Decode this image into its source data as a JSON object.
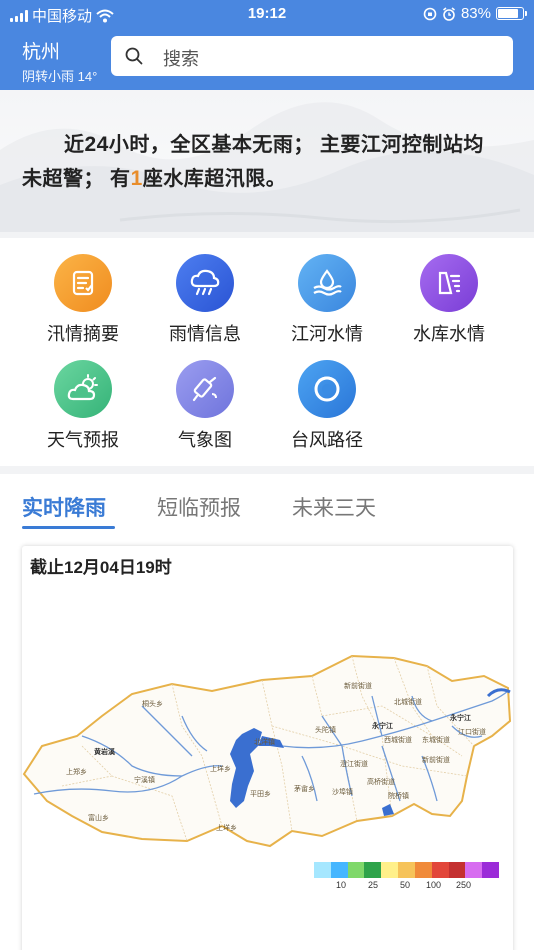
{
  "status_bar": {
    "carrier": "中国移动",
    "time": "19:12",
    "battery": "83%"
  },
  "header": {
    "city": "杭州",
    "weather": "阴转小雨 14°",
    "search_placeholder": "搜索"
  },
  "banner": {
    "p1": "近",
    "n1": "24",
    "p2": "小时，全区基本无雨；  主要江河控制站均未超警；  有",
    "n2": "1",
    "p3": "座水库超汛限。"
  },
  "menu": {
    "items": [
      {
        "label": "汛情摘要",
        "icon": "report-icon"
      },
      {
        "label": "雨情信息",
        "icon": "rain-cloud-icon"
      },
      {
        "label": "江河水情",
        "icon": "river-water-icon"
      },
      {
        "label": "水库水情",
        "icon": "reservoir-icon"
      },
      {
        "label": "天气预报",
        "icon": "weather-icon"
      },
      {
        "label": "气象图",
        "icon": "satellite-icon"
      },
      {
        "label": "台风路径",
        "icon": "typhoon-icon"
      }
    ]
  },
  "tabs": [
    {
      "label": "实时降雨",
      "active": true
    },
    {
      "label": "短临预报",
      "active": false
    },
    {
      "label": "未来三天",
      "active": false
    }
  ],
  "map": {
    "caption": "截止12月04日19时",
    "place_labels": [
      "新前街道",
      "北城街道",
      "桐头乡",
      "永宁江",
      "头陀镇",
      "永宁江",
      "江口街道",
      "北洋镇",
      "西城街道",
      "东城街道",
      "黄岩溪",
      "上郑乡",
      "宁溪镇",
      "上垟乡",
      "澄江街道",
      "新前街道",
      "高桥街道",
      "平田乡",
      "茅畲乡",
      "沙埠镇",
      "院桥镇",
      "富山乡",
      "上垟乡"
    ],
    "legend_ticks": [
      "10",
      "25",
      "50",
      "100",
      "250"
    ],
    "legend_colors": [
      "#a5e7ff",
      "#45b6ff",
      "#7fd86a",
      "#2ea34a",
      "#fff08a",
      "#f6c35a",
      "#f08a3a",
      "#e2463a",
      "#c43030",
      "#d76cf0",
      "#9b2bd8"
    ]
  }
}
